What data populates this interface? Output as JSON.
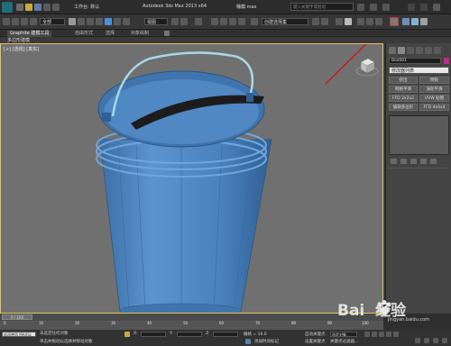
{
  "titlebar": {
    "workspace": "工作台: 默认",
    "app_title": "Autodesk 3ds Max 2013 x64",
    "file": "桶模.max",
    "search_placeholder": "键入关键字或短语"
  },
  "toolbar": {
    "selection_filter": "全部",
    "view_dropdown": "视图",
    "named_selection": "创建选择集"
  },
  "ribbon_tabs": [
    "Graphite 建模工具",
    "自由形式",
    "选择",
    "对象绘制"
  ],
  "viewport": {
    "label": "[+] [透视] [真实]",
    "ribbon_sub": "多边形建模"
  },
  "cmdpanel": {
    "object_name": "Box001",
    "modifier_list": "修改器列表",
    "buttons": [
      "挤出",
      "倒角",
      "网格平滑",
      "涡轮平滑",
      "FFD 2x2x2",
      "UVW 贴图",
      "编辑多边形",
      "FFD 4x4x4"
    ]
  },
  "timeline": {
    "frame": "0 / 100",
    "ticks": [
      "0",
      "10",
      "20",
      "30",
      "40",
      "50",
      "60",
      "70",
      "80",
      "90",
      "100"
    ]
  },
  "status": {
    "welcome": "欢迎使用 MAXSc",
    "selected": "未选定任何对象",
    "hint": "单击并拖动以选择并移动对象",
    "x_label": "X:",
    "y_label": "Y:",
    "z_label": "Z:",
    "grid": "栅格 = 10.0",
    "auto_key": "自动关键点",
    "set_key": "设置关键点",
    "selected_obj": "选定对象",
    "key_filters": "关键点过滤器...",
    "add_time_tag": "添加时间标记"
  },
  "watermark": {
    "text": "Bai  经验",
    "sub": "jingyan.baidu.com"
  },
  "colors": {
    "bucket": "#4a82bd",
    "annotation_arrow": "#c0201c"
  }
}
